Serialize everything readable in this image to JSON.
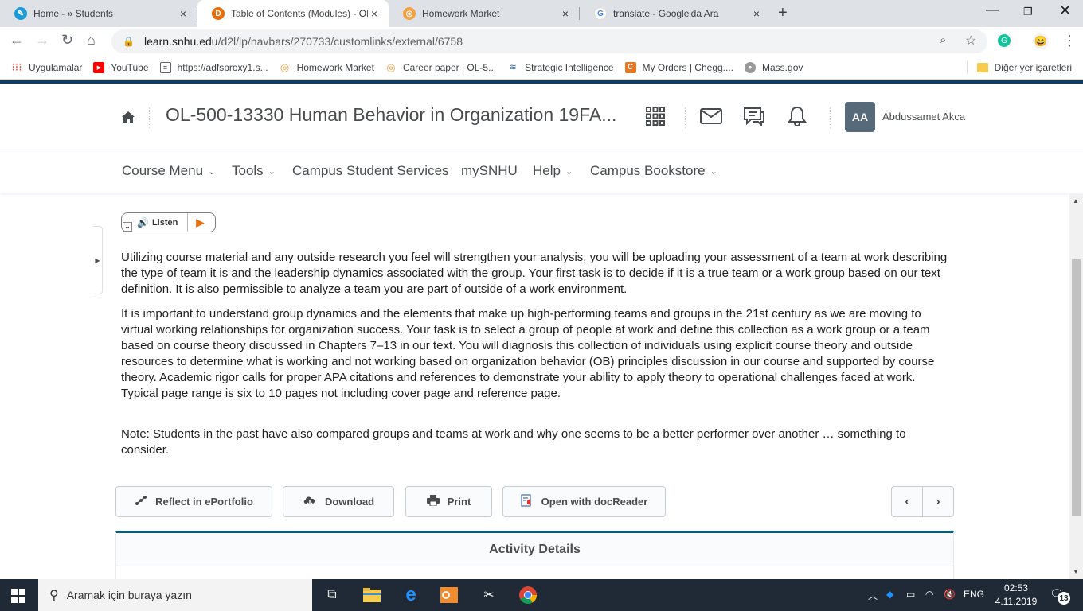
{
  "browser": {
    "tabs": [
      {
        "label": "Home - » Students",
        "close": "×"
      },
      {
        "label": "Table of Contents (Modules) - OL",
        "close": "×"
      },
      {
        "label": "Homework Market",
        "close": "×"
      },
      {
        "label": "translate - Google'da Ara",
        "close": "×"
      }
    ],
    "new_tab": "+",
    "url_host": "learn.snhu.edu",
    "url_path": "/d2l/lp/navbars/270733/customlinks/external/6758",
    "bookmarks": [
      {
        "label": "Uygulamalar"
      },
      {
        "label": "YouTube"
      },
      {
        "label": "https://adfsproxy1.s..."
      },
      {
        "label": "Homework Market"
      },
      {
        "label": "Career paper | OL-5..."
      },
      {
        "label": "Strategic Intelligence"
      },
      {
        "label": "My Orders | Chegg...."
      },
      {
        "label": "Mass.gov"
      }
    ],
    "other_bookmarks": "Diğer yer işaretleri"
  },
  "header": {
    "course_title": "OL-500-13330 Human Behavior in Organization 19FA...",
    "avatar_initials": "AA",
    "user_name": "Abdussamet Akca"
  },
  "course_nav": {
    "items": [
      {
        "label": "Course Menu",
        "dropdown": true
      },
      {
        "label": "Tools",
        "dropdown": true
      },
      {
        "label": "Campus Student Services",
        "dropdown": false
      },
      {
        "label": "mySNHU",
        "dropdown": false
      },
      {
        "label": "Help",
        "dropdown": true
      },
      {
        "label": "Campus Bookstore",
        "dropdown": true
      }
    ]
  },
  "content": {
    "listen_label": "Listen",
    "paragraphs": [
      "Utilizing course material and any outside research you feel will strengthen your analysis, you will be uploading your assessment of a team at work describing the type of team it is and the leadership dynamics associated with the group. Your first task is to decide if it is a true team or a work group based on our text definition. It is also permissible to analyze a team you are part of outside of a work environment.",
      "It is important to understand group dynamics and the elements that make up high-performing teams and groups in the 21st century as we are moving to virtual working relationships for organization success. Your task is to select a group of people at work and define this collection as a work group or a team based on course theory discussed in Chapters 7–13 in our text. You will diagnosis this collection of individuals using explicit course theory and outside resources to determine what is working and not working based on organization behavior (OB) principles discussion in our course and supported by course theory. Academic rigor calls for proper APA citations and references to demonstrate your ability to apply theory to operational challenges faced at work. Typical page range is six to 10 pages not including cover page and reference page.",
      "Note: Students in the past have also compared groups and teams at work and why one seems to be a better performer over another … something to consider."
    ],
    "actions": {
      "reflect": "Reflect in ePortfolio",
      "download": "Download",
      "print": "Print",
      "docreader": "Open with docReader"
    },
    "activity_details": "Activity Details"
  },
  "taskbar": {
    "search_placeholder": "Aramak için buraya yazın",
    "lang": "ENG",
    "time": "02:53",
    "date": "4.11.2019",
    "notifications": "13"
  },
  "colors": {
    "brand_bar": "#0a3c6e",
    "details_accent": "#0a5b78",
    "listen_play": "#e86d0d",
    "taskbar": "#1f2a36"
  }
}
